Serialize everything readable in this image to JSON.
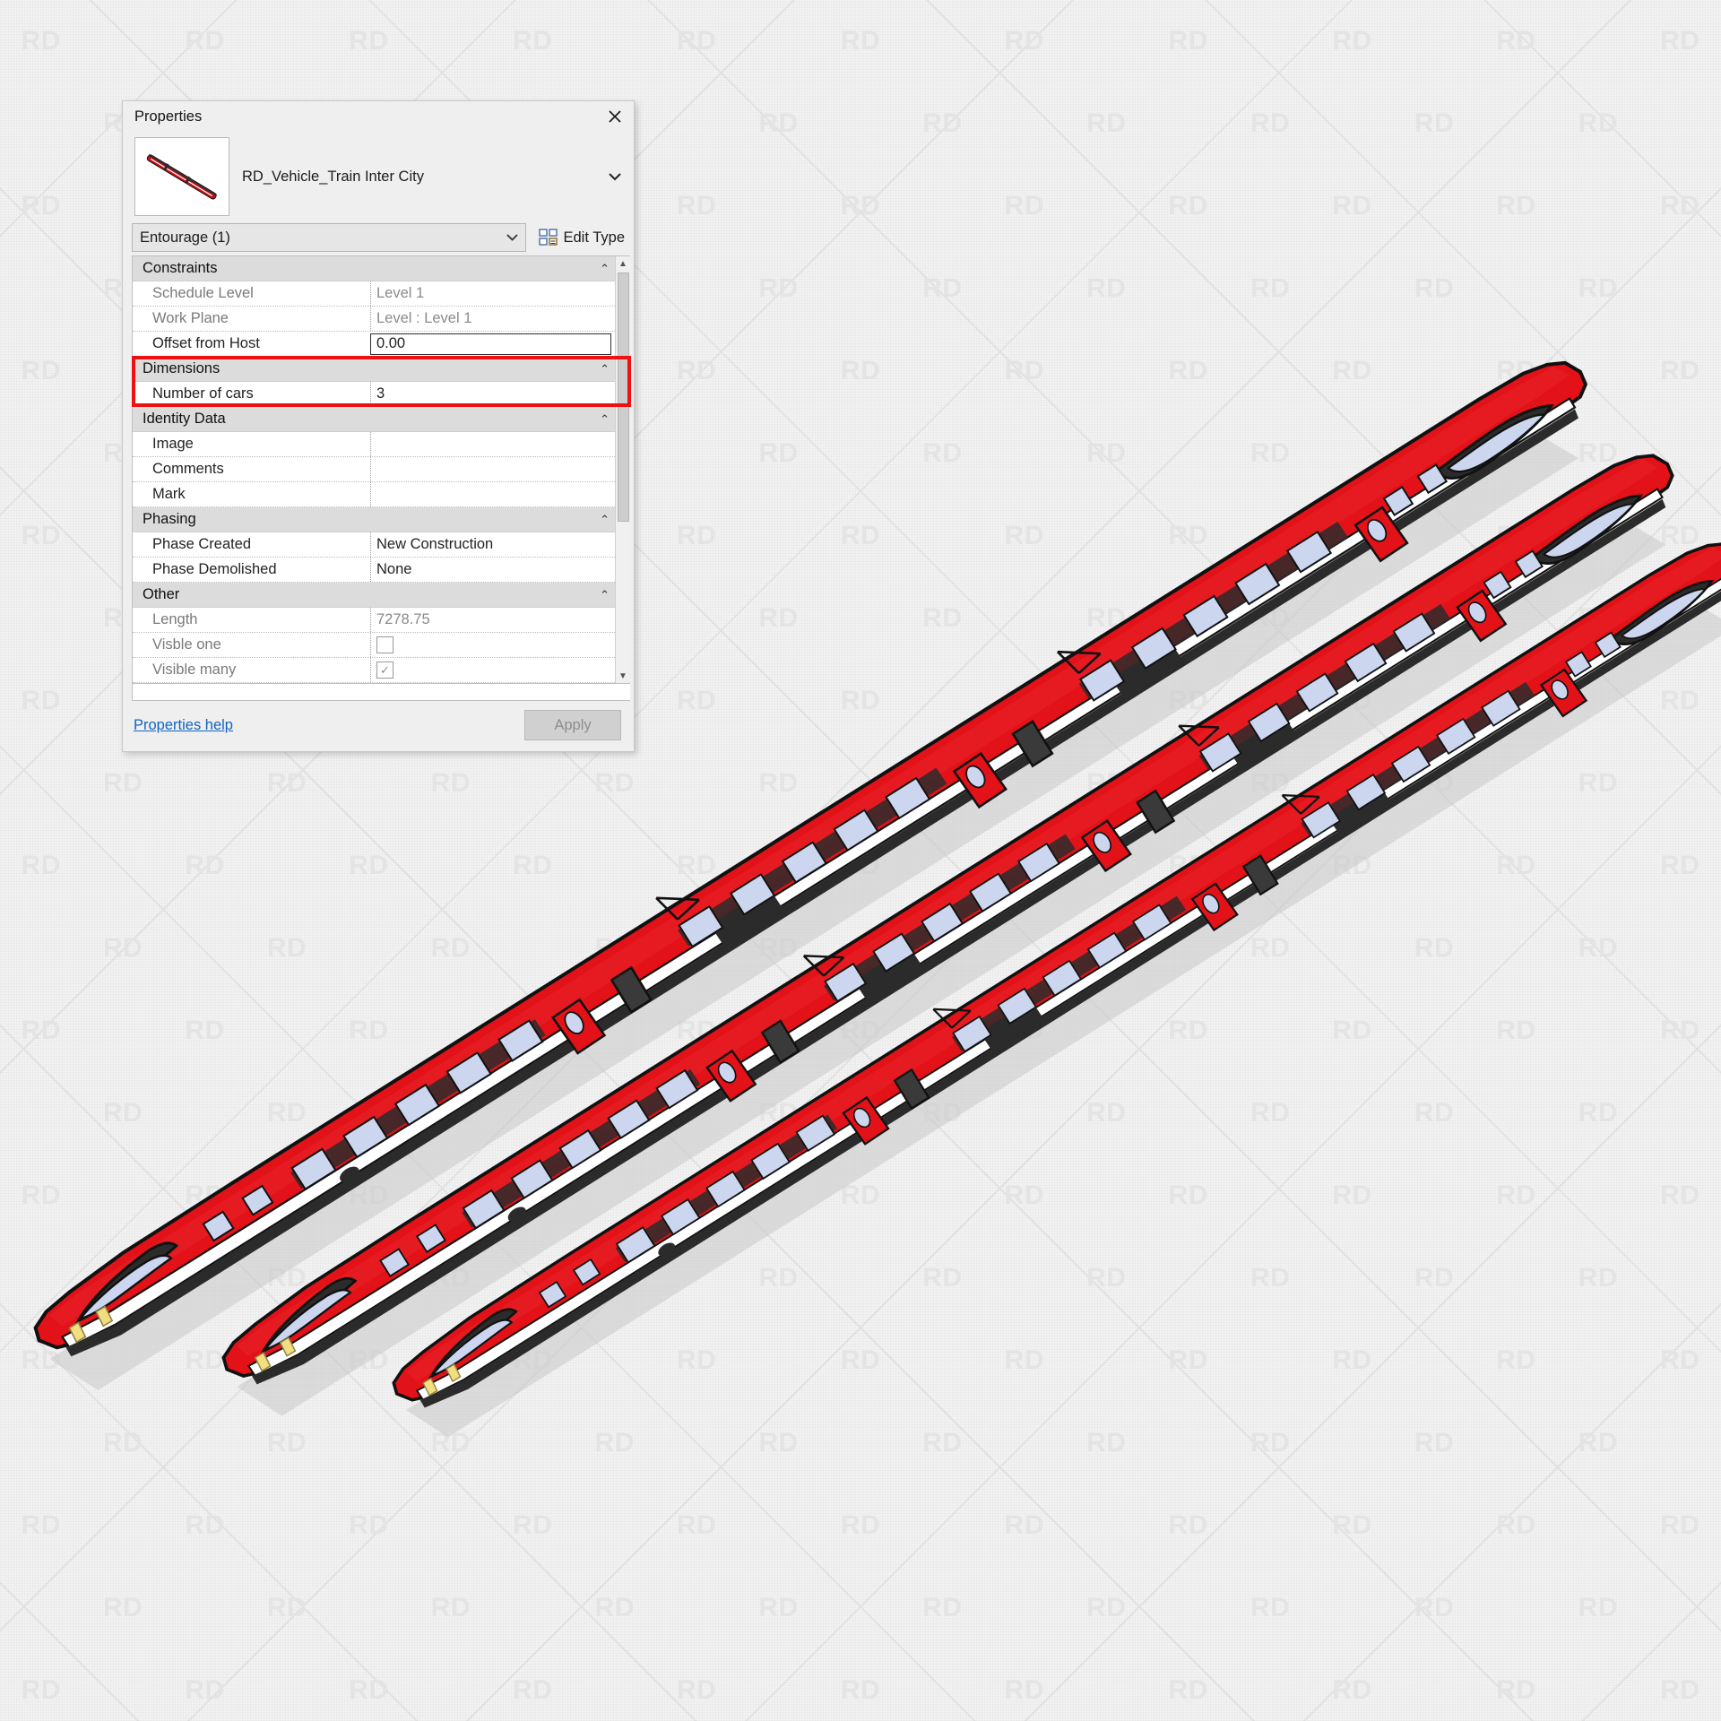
{
  "app": {
    "background_color": "#f2f2f2",
    "watermark_text": "RD"
  },
  "palette": {
    "title": "Properties",
    "close_icon": "close-icon",
    "type_name": "RD_Vehicle_Train Inter City",
    "type_dropdown_icon": "chevron-down-icon",
    "instance_selector": "Entourage (1)",
    "instance_dropdown_icon": "chevron-down-icon",
    "edit_type_label": "Edit Type",
    "edit_type_icon": "edit-type-icon",
    "footer": {
      "help_link": "Properties help",
      "apply_label": "Apply"
    },
    "scroll": {
      "up_icon": "chevron-up-icon",
      "down_icon": "chevron-down-icon"
    },
    "highlight_color": "#ef1111",
    "sections": [
      {
        "name": "Constraints",
        "collapse_icon": "double-chevron-up-icon",
        "rows": [
          {
            "label": "Schedule Level",
            "value": "Level 1",
            "readonly": true,
            "type": "text"
          },
          {
            "label": "Work Plane",
            "value": "Level : Level 1",
            "readonly": true,
            "type": "text"
          },
          {
            "label": "Offset from Host",
            "value": "0.00",
            "readonly": false,
            "type": "text",
            "focused": true
          }
        ]
      },
      {
        "name": "Dimensions",
        "collapse_icon": "double-chevron-up-icon",
        "highlighted": true,
        "rows": [
          {
            "label": "Number of cars",
            "value": "3",
            "readonly": false,
            "type": "text"
          }
        ]
      },
      {
        "name": "Identity Data",
        "collapse_icon": "double-chevron-up-icon",
        "rows": [
          {
            "label": "Image",
            "value": "",
            "readonly": false,
            "type": "text"
          },
          {
            "label": "Comments",
            "value": "",
            "readonly": false,
            "type": "text"
          },
          {
            "label": "Mark",
            "value": "",
            "readonly": false,
            "type": "text"
          }
        ]
      },
      {
        "name": "Phasing",
        "collapse_icon": "double-chevron-up-icon",
        "rows": [
          {
            "label": "Phase Created",
            "value": "New Construction",
            "readonly": false,
            "type": "text"
          },
          {
            "label": "Phase Demolished",
            "value": "None",
            "readonly": false,
            "type": "text"
          }
        ]
      },
      {
        "name": "Other",
        "collapse_icon": "double-chevron-up-icon",
        "rows": [
          {
            "label": "Length",
            "value": "7278.75",
            "readonly": true,
            "type": "text"
          },
          {
            "label": "Visble one",
            "value": "",
            "readonly": true,
            "type": "checkbox",
            "checked": false
          },
          {
            "label": "Visible many",
            "value": "",
            "readonly": true,
            "type": "checkbox",
            "checked": true
          }
        ]
      }
    ]
  },
  "viewport": {
    "model_name": "RD_Vehicle_Train Inter City",
    "train_count": 3,
    "cars_per_train": 3,
    "body_color": "#e31219",
    "window_color": "#ccd6ef",
    "dark_color": "#2b2b2b",
    "stripe_color": "#ffffff",
    "headlight_color": "#f2de80",
    "shadow_color": "#c9c9c9"
  }
}
